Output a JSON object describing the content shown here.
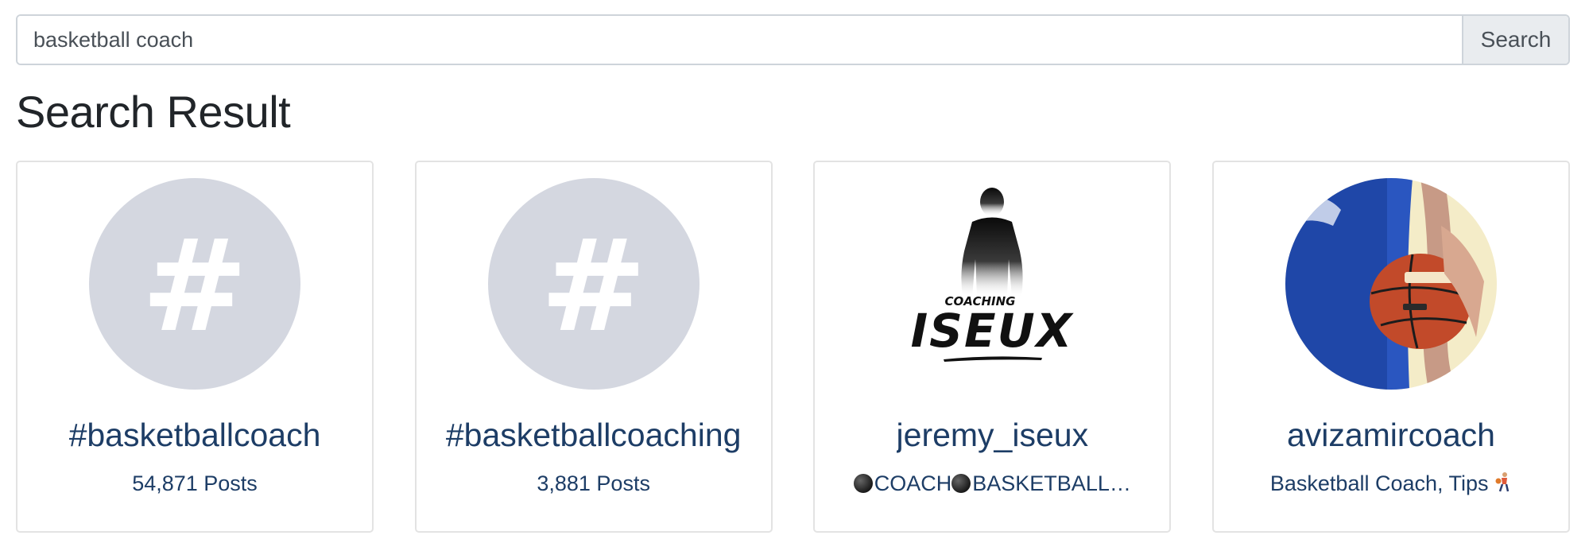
{
  "search": {
    "value": "basketball coach",
    "button_label": "Search"
  },
  "page": {
    "title": "Search Result"
  },
  "results": [
    {
      "kind": "hashtag",
      "avatar_icon": "hashtag-icon",
      "avatar_glyph": "#",
      "title": "#basketballcoach",
      "subtitle": "54,871 Posts"
    },
    {
      "kind": "hashtag",
      "avatar_icon": "hashtag-icon",
      "avatar_glyph": "#",
      "title": "#basketballcoaching",
      "subtitle": "3,881 Posts"
    },
    {
      "kind": "user",
      "avatar_icon": "coaching-iseux-logo",
      "logo_text_small": "COACHING",
      "logo_text_large": "ISEUX",
      "title": "jeremy_iseux",
      "subtitle_parts": [
        "COACH",
        "BASKETBALL…"
      ]
    },
    {
      "kind": "user",
      "avatar_icon": "basketball-photo",
      "title": "avizamircoach",
      "subtitle": "Basketball Coach, Tips",
      "subtitle_icon": "basketball-player-icon"
    }
  ],
  "colors": {
    "link": "#1d3d66",
    "hashtag_avatar_bg": "#d4d7e0",
    "card_border": "#e3e3e3",
    "button_bg": "#e9ecef"
  }
}
